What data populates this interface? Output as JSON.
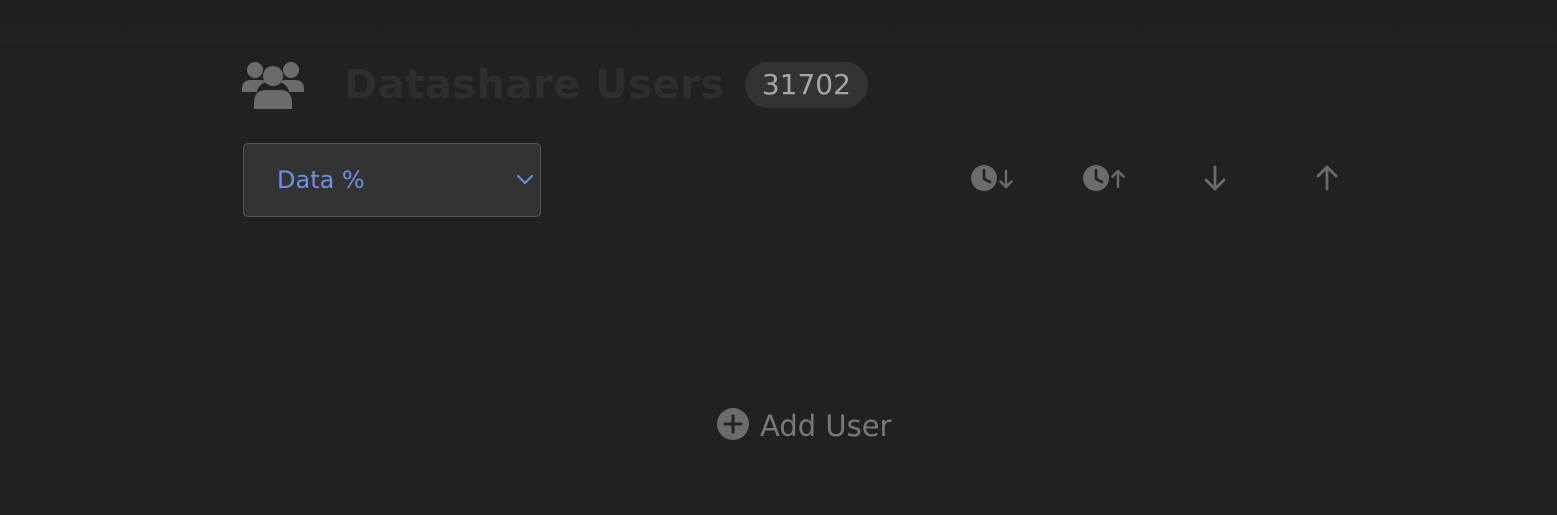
{
  "header": {
    "title": "Datashare Users",
    "count": "31702",
    "icon": "users-group-icon"
  },
  "sort": {
    "selected": "Data %"
  },
  "sort_buttons": [
    {
      "icon": "clock-sort-descending-icon"
    },
    {
      "icon": "clock-sort-ascending-icon"
    },
    {
      "icon": "arrow-down-icon"
    },
    {
      "icon": "arrow-up-icon"
    }
  ],
  "add_user": {
    "label": "Add User",
    "icon": "plus-circle-icon"
  },
  "colors": {
    "background": "#212121",
    "accent": "#6f8fe6",
    "icon": "#6b6b6b",
    "title": "#2e2e2e",
    "badge_bg": "#333333"
  }
}
